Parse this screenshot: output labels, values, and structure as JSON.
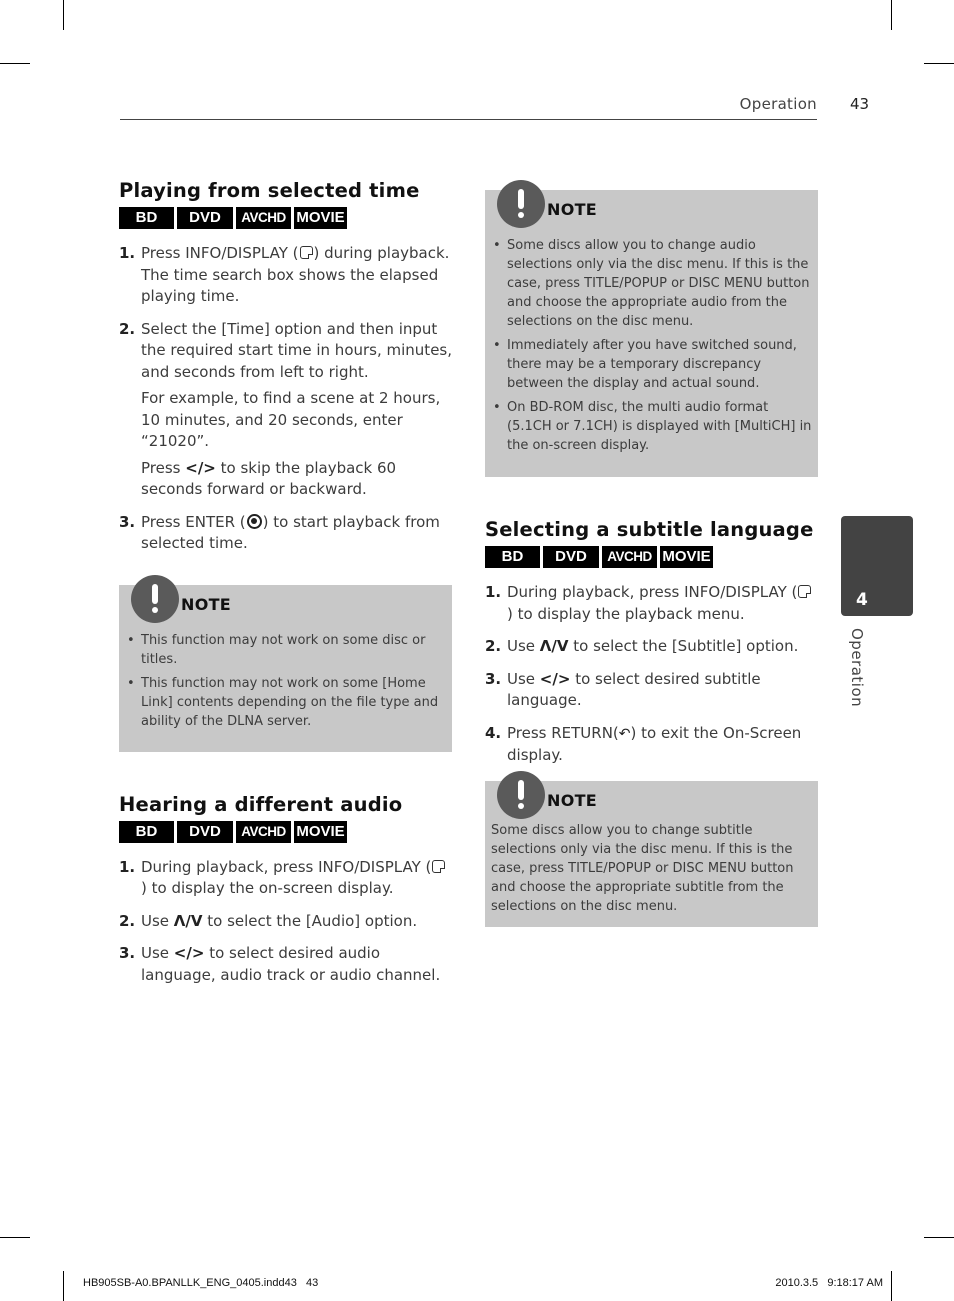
{
  "header": {
    "section": "Operation",
    "page_number": "43"
  },
  "side_tab": {
    "chapter_number": "4",
    "chapter_label": "Operation"
  },
  "badges": [
    "BD",
    "DVD",
    "AVCHD",
    "MOVIE"
  ],
  "sections": {
    "playing_time": {
      "title": "Playing from selected time",
      "steps": [
        {
          "num": "1.",
          "pre": "Press INFO/DISPLAY (",
          "post": ") during playback. The time search box shows the elapsed playing time."
        },
        {
          "num": "2.",
          "text": " Select the [Time] option and then input the required start time in hours, minutes, and seconds from left to right.",
          "example": "For example, to find a scene at 2 hours, 10 minutes, and 20 seconds, enter “21020”.",
          "skip_pre": "Press ",
          "skip_glyph": "</>",
          "skip_post": " to skip the playback 60 seconds forward or backward."
        },
        {
          "num": "3.",
          "pre": "Press ENTER (",
          "post": ") to start playback from selected time."
        }
      ],
      "note": {
        "title": "NOTE",
        "items": [
          "This function may not work on some disc or titles.",
          "This function may not work on some [Home Link] contents depending on the file type and ability of the DLNA server."
        ]
      }
    },
    "audio": {
      "title": "Hearing a different audio",
      "steps": [
        {
          "num": "1.",
          "pre": "During playback, press INFO/DISPLAY (",
          "post": ") to display the on-screen display."
        },
        {
          "num": "2.",
          "pre": "Use ",
          "glyph": "Λ/V",
          "post": " to select the [Audio] option."
        },
        {
          "num": "3.",
          "pre": "Use ",
          "glyph": "</>",
          "post": " to select desired audio language, audio track or audio channel."
        }
      ],
      "note": {
        "title": "NOTE",
        "items": [
          "Some discs allow you to change audio selections only via the disc menu. If this is the case, press TITLE/POPUP or DISC MENU button and choose the appropriate audio from the selections on the disc menu.",
          "Immediately after you have switched sound, there may be a temporary discrepancy between the display and actual sound.",
          "On BD-ROM disc, the multi audio format (5.1CH or 7.1CH) is displayed with [MultiCH] in the on-screen display."
        ]
      }
    },
    "subtitle": {
      "title": "Selecting a subtitle language",
      "steps": [
        {
          "num": "1.",
          "pre": "During playback, press INFO/DISPLAY (",
          "post": ") to display the playback menu."
        },
        {
          "num": "2.",
          "pre": "Use ",
          "glyph": "Λ/V",
          "post": " to select the [Subtitle] option."
        },
        {
          "num": "3.",
          "pre": "Use ",
          "glyph": "</>",
          "post": " to select desired subtitle language."
        },
        {
          "num": "4.",
          "pre": "Press RETURN(",
          "post": ") to exit the On-Screen display."
        }
      ],
      "note": {
        "title": "NOTE",
        "text": "Some discs allow you to change subtitle selections only via the disc menu. If this is the case, press TITLE/POPUP or DISC MENU button and choose the appropriate subtitle from the selections on the disc menu."
      }
    }
  },
  "footer": {
    "file": "HB905SB-A0.BPANLLK_ENG_0405.indd43   43",
    "timestamp": "2010.3.5   9:18:17 AM"
  }
}
